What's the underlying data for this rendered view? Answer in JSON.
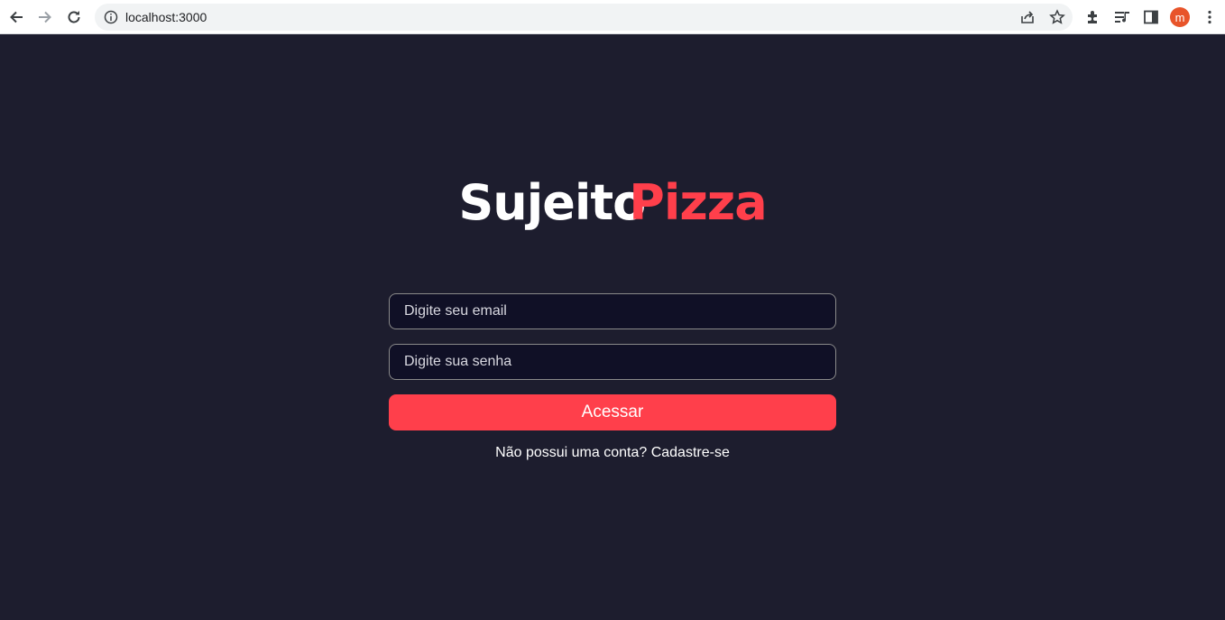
{
  "browser": {
    "url": "localhost:3000",
    "avatar_initial": "m",
    "icons": [
      "back-icon",
      "forward-icon",
      "reload-icon",
      "info-icon",
      "share-icon",
      "star-icon",
      "extensions-icon",
      "reading-list-icon",
      "side-panel-icon",
      "more-icon"
    ]
  },
  "brand": {
    "part1": "Sujeito",
    "part2": "Pizza",
    "color_white": "#ffffff",
    "color_accent": "#ff3f4b"
  },
  "form": {
    "email_placeholder": "Digite seu email",
    "password_placeholder": "Digite sua senha",
    "submit_label": "Acessar"
  },
  "signup": {
    "text": "Não possui uma conta? Cadastre-se"
  },
  "colors": {
    "background": "#1d1d2e",
    "input_bg": "#101026",
    "accent": "#ff3f4b"
  }
}
